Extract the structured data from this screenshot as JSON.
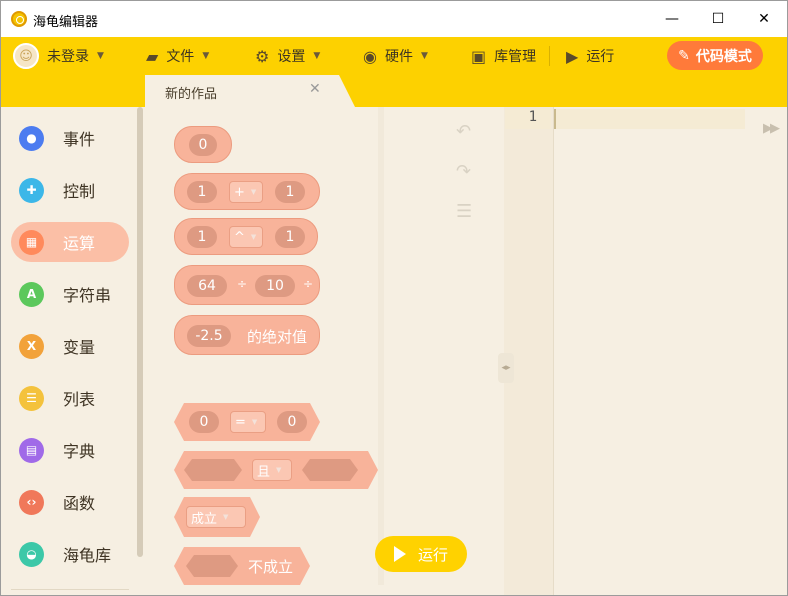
{
  "window": {
    "title": "海龟编辑器",
    "controls": {
      "minimize": "—",
      "maximize": "☐",
      "close": "✕"
    }
  },
  "menubar": {
    "user": "未登录",
    "file": "文件",
    "settings": "设置",
    "hardware": "硬件",
    "library": "库管理",
    "run": "运行",
    "code_mode": "代码模式"
  },
  "tab": {
    "label": "新的作品",
    "close": "✕"
  },
  "sidebar": {
    "items": [
      {
        "label": "事件",
        "color": "#4c7cf0"
      },
      {
        "label": "控制",
        "color": "#3cb7e8"
      },
      {
        "label": "运算",
        "color": "#ff8a5c"
      },
      {
        "label": "字符串",
        "color": "#5cc85c"
      },
      {
        "label": "变量",
        "color": "#f2a23a"
      },
      {
        "label": "列表",
        "color": "#f4c23c"
      },
      {
        "label": "字典",
        "color": "#a06ae8"
      },
      {
        "label": "函数",
        "color": "#f0785a"
      },
      {
        "label": "海龟库",
        "color": "#3cc8a8"
      }
    ]
  },
  "blocks": {
    "number": "0",
    "add": {
      "left": "1",
      "op": "+",
      "right": "1"
    },
    "pow": {
      "left": "1",
      "op": "^",
      "right": "1"
    },
    "div": {
      "left": "64",
      "op": "÷",
      "right": "10",
      "op2": "÷"
    },
    "abs": {
      "value": "-2.5",
      "label": "的绝对值"
    },
    "eq": {
      "left": "0",
      "op": "=",
      "right": "0"
    },
    "and": {
      "op": "且"
    },
    "true": {
      "label": "成立"
    },
    "not": {
      "label": "不成立"
    }
  },
  "run_button": "运行",
  "editor": {
    "line_number": "1"
  }
}
